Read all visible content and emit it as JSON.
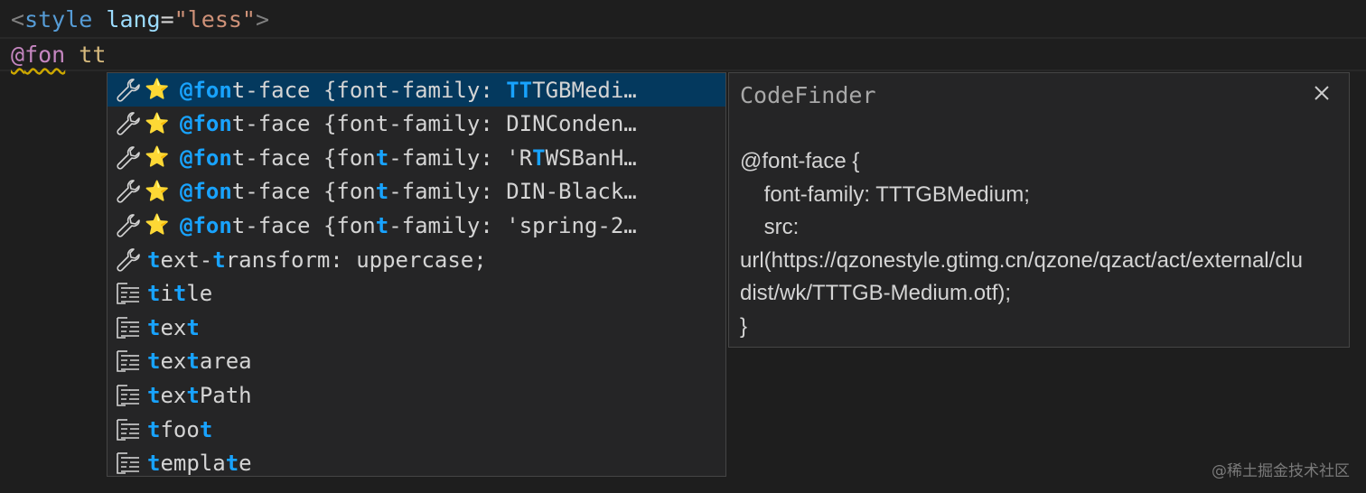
{
  "editor": {
    "line1": {
      "open_bracket": "<",
      "tag": "style",
      "attr": "lang",
      "eq": "=",
      "value": "\"less\"",
      "close_bracket": ">"
    },
    "line2": {
      "at": "@",
      "word": "fon",
      "space": " ",
      "typed": "tt"
    }
  },
  "suggest": {
    "items": [
      {
        "icon": "wrench-icon",
        "star": true,
        "parts": [
          [
            "@fon",
            true
          ],
          [
            "t-face {font-family: ",
            false
          ],
          [
            "TT",
            true
          ],
          [
            "TGBMedi…",
            false
          ]
        ]
      },
      {
        "icon": "wrench-icon",
        "star": true,
        "parts": [
          [
            "@fon",
            true
          ],
          [
            "t-face {font-family: DINConden…",
            false
          ]
        ]
      },
      {
        "icon": "wrench-icon",
        "star": true,
        "parts": [
          [
            "@fon",
            true
          ],
          [
            "t-face {fon",
            false
          ],
          [
            "t",
            true
          ],
          [
            "-family: 'R",
            false
          ],
          [
            "T",
            true
          ],
          [
            "WSBanH…",
            false
          ]
        ]
      },
      {
        "icon": "wrench-icon",
        "star": true,
        "parts": [
          [
            "@fon",
            true
          ],
          [
            "t-face {fon",
            false
          ],
          [
            "t",
            true
          ],
          [
            "-family: DIN-Black…",
            false
          ]
        ]
      },
      {
        "icon": "wrench-icon",
        "star": true,
        "parts": [
          [
            "@fon",
            true
          ],
          [
            "t-face {fon",
            false
          ],
          [
            "t",
            true
          ],
          [
            "-family: 'spring-2…",
            false
          ]
        ]
      },
      {
        "icon": "wrench-icon",
        "star": false,
        "parts": [
          [
            "t",
            true
          ],
          [
            "ext-",
            false
          ],
          [
            "t",
            true
          ],
          [
            "ransform: uppercase;",
            false
          ]
        ]
      },
      {
        "icon": "snippet-icon",
        "star": false,
        "parts": [
          [
            "t",
            true
          ],
          [
            "i",
            false
          ],
          [
            "t",
            true
          ],
          [
            "le",
            false
          ]
        ]
      },
      {
        "icon": "snippet-icon",
        "star": false,
        "parts": [
          [
            "t",
            true
          ],
          [
            "ex",
            false
          ],
          [
            "t",
            true
          ]
        ]
      },
      {
        "icon": "snippet-icon",
        "star": false,
        "parts": [
          [
            "t",
            true
          ],
          [
            "ex",
            false
          ],
          [
            "t",
            true
          ],
          [
            "area",
            false
          ]
        ]
      },
      {
        "icon": "snippet-icon",
        "star": false,
        "parts": [
          [
            "t",
            true
          ],
          [
            "ex",
            false
          ],
          [
            "t",
            true
          ],
          [
            "Path",
            false
          ]
        ]
      },
      {
        "icon": "snippet-icon",
        "star": false,
        "parts": [
          [
            "t",
            true
          ],
          [
            "foo",
            false
          ],
          [
            "t",
            true
          ]
        ]
      },
      {
        "icon": "snippet-icon",
        "star": false,
        "parts": [
          [
            "t",
            true
          ],
          [
            "empla",
            false
          ],
          [
            "t",
            true
          ],
          [
            "e",
            false
          ]
        ]
      }
    ],
    "star_glyph": "⭐"
  },
  "details": {
    "title": "CodeFinder",
    "body": "@font-face {\n    font-family: TTTGBMedium;\n    src:\nurl(https://qzonestyle.gtimg.cn/qzone/qzact/act/external/clu\ndist/wk/TTTGB-Medium.otf);\n}"
  },
  "watermark": "@稀土掘金技术社区",
  "colors": {
    "background": "#1e1e1e",
    "widget": "#252526",
    "selected": "#04395e",
    "highlight": "#18a3ff"
  }
}
